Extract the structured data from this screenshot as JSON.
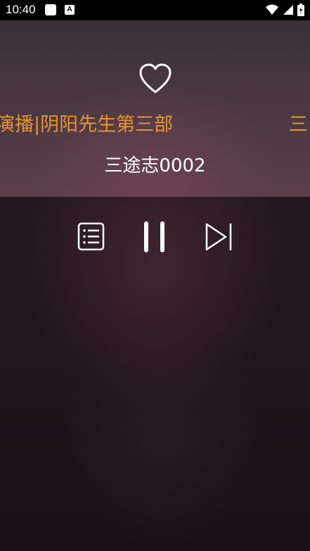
{
  "status_bar": {
    "time": "10:40",
    "icons": [
      "notification-square-icon",
      "font-a-icon",
      "wifi-icon",
      "signal-icon",
      "battery-charging-icon"
    ]
  },
  "player": {
    "marquee_text": "演播|阴阳先生第三部",
    "marquee_repeat": "三",
    "track_title": "三途志0002",
    "favorite_icon": "heart-outline-icon",
    "controls": [
      "playlist-icon",
      "pause-icon",
      "skip-next-icon"
    ]
  },
  "colors": {
    "accent": "#e8952e",
    "text": "#ffffff",
    "status_bar_bg": "#000000"
  }
}
